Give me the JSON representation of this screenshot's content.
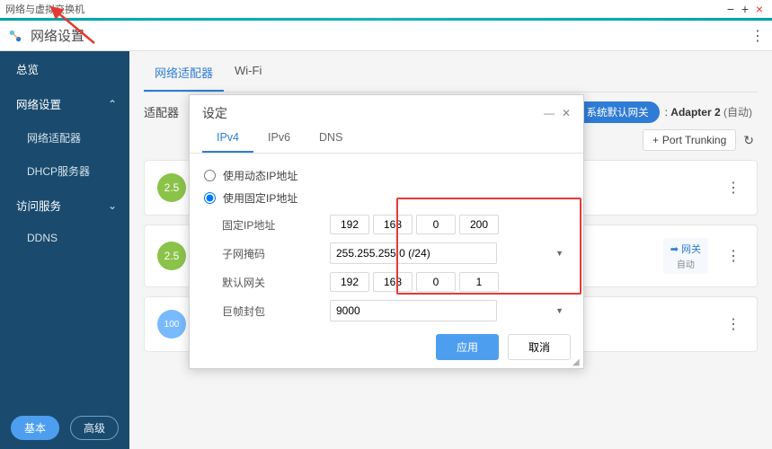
{
  "window": {
    "title": "网络与虚拟交换机",
    "min": "−",
    "max": "+",
    "close": "×"
  },
  "app": {
    "title": "网络设置",
    "menu_glyph": "⋮"
  },
  "sidebar": {
    "items": {
      "overview": "总览",
      "network_settings": "网络设置",
      "adapter": "网络适配器",
      "dhcp": "DHCP服务器",
      "access_services": "访问服务",
      "ddns": "DDNS"
    },
    "chev_open": "⌃",
    "chev_closed": "⌄",
    "footer": {
      "basic": "基本",
      "advanced": "高级"
    }
  },
  "content": {
    "tabs": {
      "adapter": "网络适配器",
      "wifi": "Wi-Fi"
    },
    "subtitle": "适配器",
    "gateway_chip": {
      "icon": "⏵",
      "text": "系统默认网关"
    },
    "adapter_label": "Adapter 2",
    "adapter_auto": "(自动)",
    "adapter_sep": ": ",
    "port_trunking": "Port Trunking",
    "plus": "+",
    "refresh_glyph": "↻",
    "cards": [
      {
        "badge": "2.5",
        "gateway": false
      },
      {
        "badge": "2.5",
        "gateway": true,
        "gateway_icon": "➡",
        "gateway_label": "网关",
        "gateway_sub": "自动"
      },
      {
        "badge": "100",
        "gateway": false
      }
    ]
  },
  "modal": {
    "title": "设定",
    "minimize": "—",
    "close": "✕",
    "tabs": {
      "ipv4": "IPv4",
      "ipv6": "IPv6",
      "dns": "DNS"
    },
    "radios": {
      "dynamic": "使用动态IP地址",
      "static": "使用固定IP地址"
    },
    "labels": {
      "fixed_ip": "固定IP地址",
      "subnet": "子网掩码",
      "default_gw": "默认网关",
      "jumbo": "巨帧封包"
    },
    "values": {
      "ip": {
        "o1": "192",
        "o2": "168",
        "o3": "0",
        "o4": "200"
      },
      "subnet": "255.255.255.0 (/24)",
      "gw": {
        "o1": "192",
        "o2": "168",
        "o3": "0",
        "o4": "1"
      },
      "jumbo": "9000"
    },
    "buttons": {
      "apply": "应用",
      "cancel": "取消"
    },
    "resize": "◢"
  }
}
